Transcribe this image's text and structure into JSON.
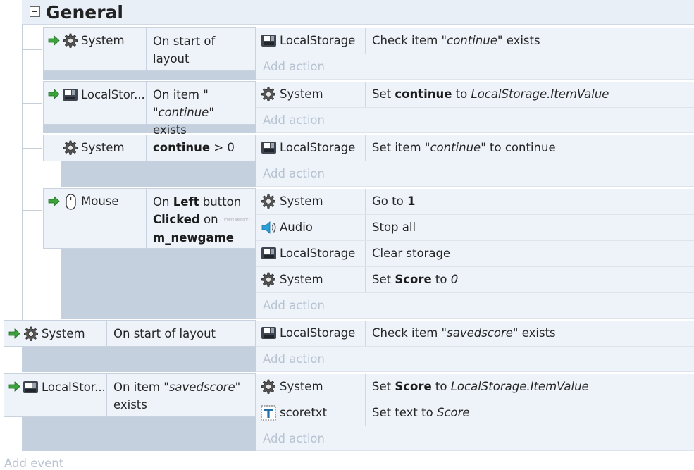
{
  "group": {
    "title": "General"
  },
  "labels": {
    "add_action": "Add action",
    "add_event": "Add event"
  },
  "events": [
    {
      "condition": {
        "object": "System",
        "text_a": "On start of layout"
      },
      "actions": [
        {
          "object": "LocalStorage",
          "a": "Check item \"",
          "b": "continue",
          "c": "\" exists"
        }
      ]
    },
    {
      "condition": {
        "object": "LocalStor...",
        "a": "On item \"",
        "b": "continue",
        "c": "\" exists"
      },
      "actions": [
        {
          "object": "System",
          "a": "Set ",
          "b": "continue",
          "c": " to ",
          "d": "LocalStorage.ItemValue"
        }
      ]
    },
    {
      "condition": {
        "object": "System",
        "b": "continue",
        "c": " > 0"
      },
      "actions": [
        {
          "object": "LocalStorage",
          "a": "Set item \"",
          "b": "continue",
          "c": "\" to continue"
        }
      ]
    },
    {
      "condition": {
        "object": "Mouse",
        "a": "On ",
        "b": "Left",
        "c": " button",
        "d": "Clicked",
        "e": " on",
        "f": "m_newgame",
        "mini": "(*Mini sketch*)"
      },
      "actions": [
        {
          "object": "System",
          "a": "Go to ",
          "b": "1"
        },
        {
          "object": "Audio",
          "a": "Stop all"
        },
        {
          "object": "LocalStorage",
          "a": "Clear storage"
        },
        {
          "object": "System",
          "a": "Set ",
          "b": "Score",
          "c": " to ",
          "d": "0"
        }
      ]
    },
    {
      "condition": {
        "object": "System",
        "text_a": "On start of layout"
      },
      "actions": [
        {
          "object": "LocalStorage",
          "a": "Check item \"",
          "b": "savedscore",
          "c": "\" exists"
        }
      ]
    },
    {
      "condition": {
        "object": "LocalStor...",
        "a": "On item \"",
        "b": "savedscore",
        "c": "\"",
        "d": "exists"
      },
      "actions": [
        {
          "object": "System",
          "a": "Set ",
          "b": "Score",
          "c": " to ",
          "d": "LocalStorage.ItemValue"
        },
        {
          "object": "scoretxt",
          "a": "Set text to ",
          "b": "Score"
        }
      ]
    }
  ],
  "colors": {
    "bar": "#c4d0de",
    "row": "#eef3fa",
    "arrow": "#3aa33a",
    "add": "#b8c3d1"
  },
  "icons": [
    "trigger-arrow-icon",
    "gear-icon",
    "storage-icon",
    "mouse-icon",
    "speaker-icon",
    "text-icon",
    "collapse-icon"
  ]
}
